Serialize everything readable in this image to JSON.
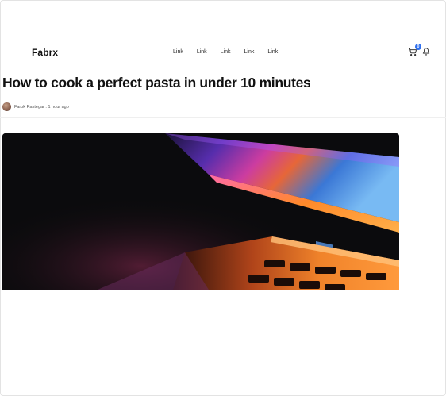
{
  "nav": {
    "brand": "Fabrx",
    "links": [
      "Link",
      "Link",
      "Link",
      "Link",
      "Link"
    ],
    "cart_count": "0"
  },
  "article": {
    "title": "How to cook a perfect pasta in under 10 minutes",
    "author": "Farok Rastegar",
    "time": "1 hour ago"
  },
  "icons": {
    "cart": "shopping-cart-icon",
    "notifications": "bell-icon",
    "avatar": "author-avatar"
  },
  "colors": {
    "badge": "#2f6fed",
    "text": "#111111"
  }
}
